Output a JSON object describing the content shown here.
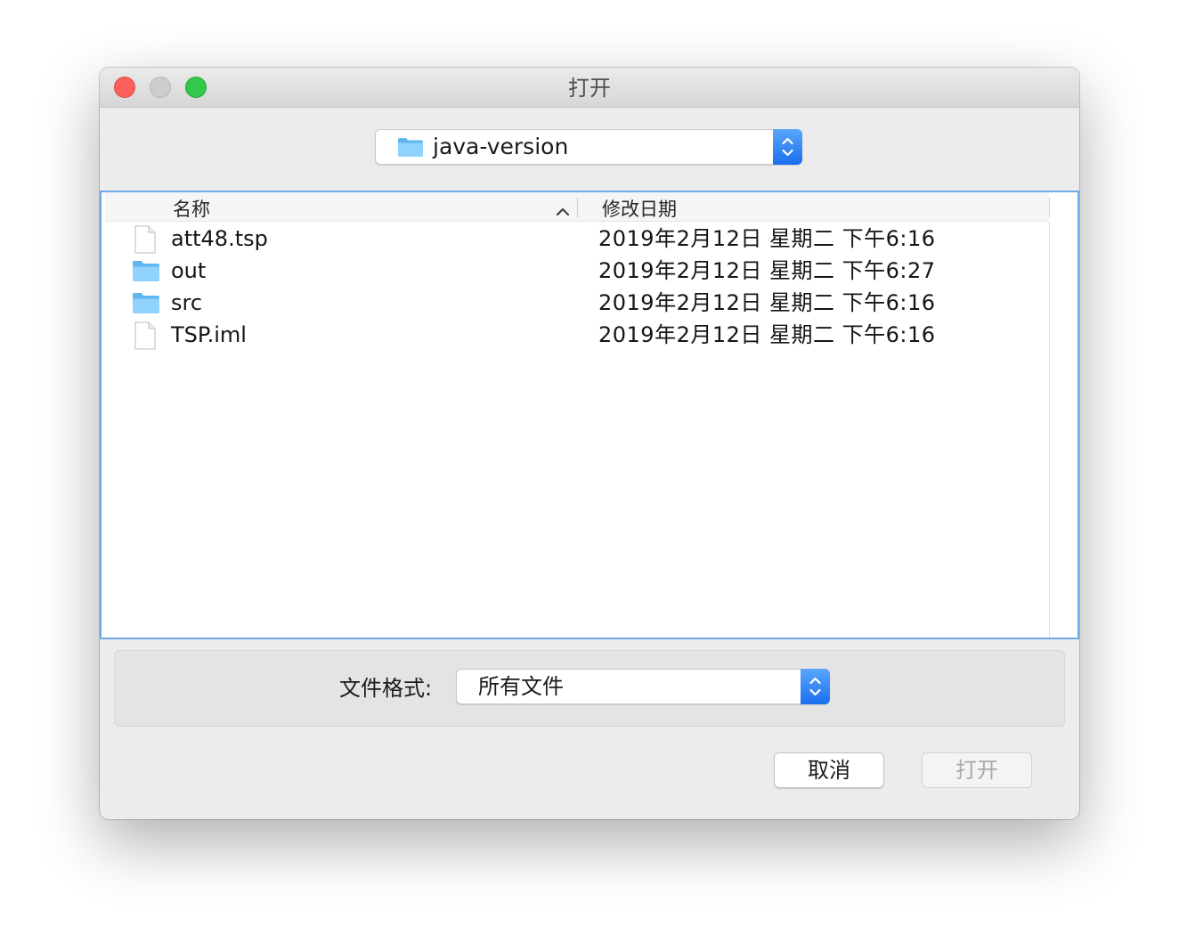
{
  "window": {
    "title": "打开"
  },
  "directory": {
    "current": "java-version",
    "icon": "folder-icon"
  },
  "columns": {
    "name": "名称",
    "modified": "修改日期"
  },
  "files": [
    {
      "name": "att48.tsp",
      "date": "2019年2月12日 星期二 下午6:16",
      "icon": "document-icon"
    },
    {
      "name": "out",
      "date": "2019年2月12日 星期二 下午6:27",
      "icon": "folder-icon"
    },
    {
      "name": "src",
      "date": "2019年2月12日 星期二 下午6:16",
      "icon": "folder-icon"
    },
    {
      "name": "TSP.iml",
      "date": "2019年2月12日 星期二 下午6:16",
      "icon": "document-icon"
    }
  ],
  "filter": {
    "label": "文件格式:",
    "selected": "所有文件"
  },
  "buttons": {
    "cancel": "取消",
    "open": "打开"
  },
  "colors": {
    "accent": "#1a6ff0",
    "focus_ring": "#6ea9e8",
    "close": "#fc605c",
    "maximize": "#34c84a",
    "folder": "#6cc3f7"
  }
}
